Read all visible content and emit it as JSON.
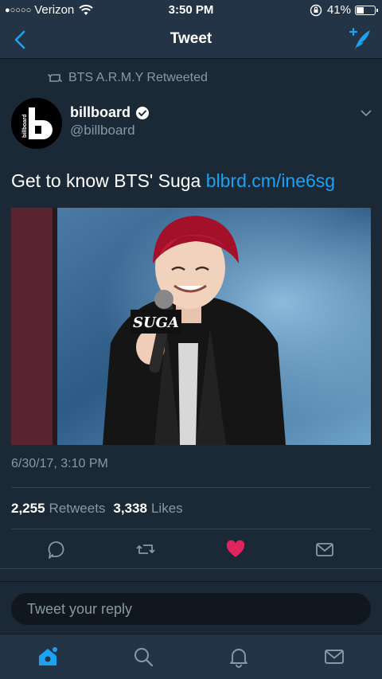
{
  "status_bar": {
    "signal_dots": "●○○○○",
    "carrier": "Verizon",
    "time": "3:50 PM",
    "battery_pct": "41%"
  },
  "nav": {
    "title": "Tweet",
    "back_icon": "chevron-left-icon",
    "compose_icon": "compose-tweet-icon"
  },
  "tweet": {
    "retweeted_by": "BTS A.R.M.Y Retweeted",
    "author_name": "billboard",
    "author_handle": "@billboard",
    "avatar_text": "billboard",
    "text": "Get to know BTS' Suga ",
    "link": "blbrd.cm/ine6sg",
    "media_caption_text": "SUGA",
    "timestamp": "6/30/17, 3:10 PM",
    "retweets_count": "2,255",
    "retweets_label": "Retweets",
    "likes_count": "3,338",
    "likes_label": "Likes",
    "liked": true
  },
  "reply_peek": {
    "name": ""
  },
  "reply_bar": {
    "placeholder": "Tweet your reply"
  },
  "tab_bar": {
    "items": [
      "home-icon",
      "search-icon",
      "notifications-icon",
      "messages-icon"
    ]
  },
  "colors": {
    "accent": "#1da1f2",
    "like": "#e0245e",
    "background": "#1b2836",
    "bar": "#243447",
    "muted": "#8899a6"
  }
}
